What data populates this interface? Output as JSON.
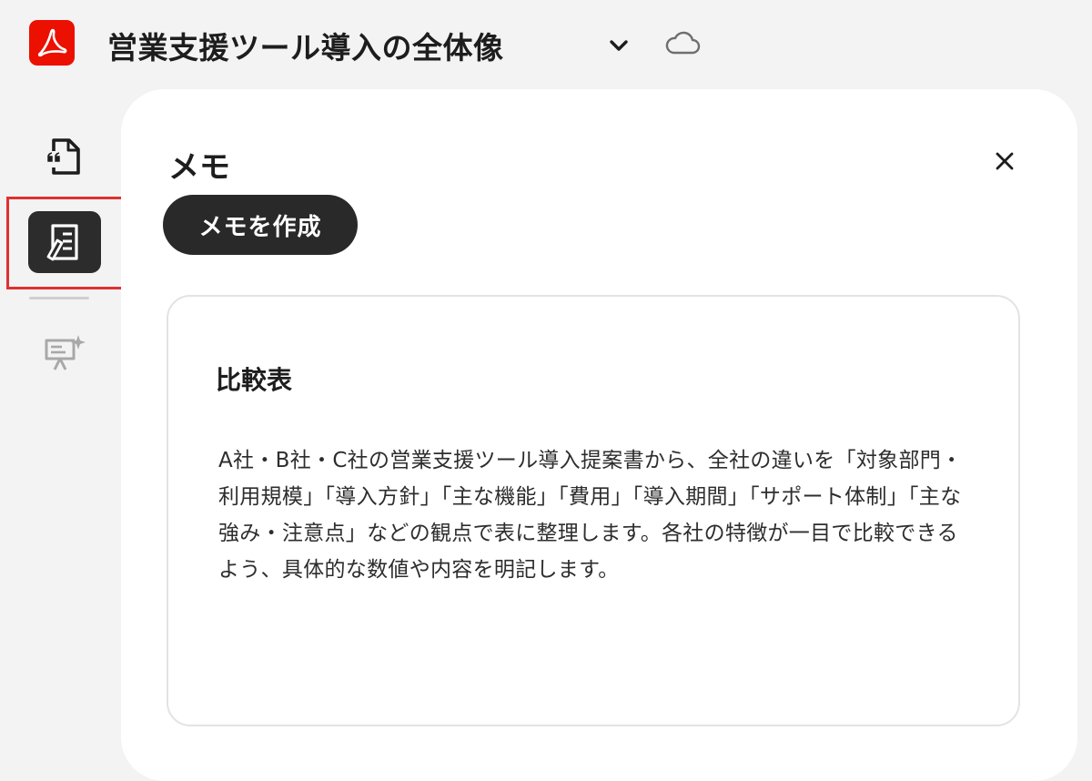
{
  "app": {
    "logo_icon": "acrobat-logo-icon",
    "brand_color": "#eb1000"
  },
  "header": {
    "document_title": "営業支援ツール導入の全体像",
    "chevron_icon": "chevron-down-icon",
    "cloud_icon": "cloud-icon"
  },
  "rail": {
    "items": [
      {
        "icon": "quote-document-icon",
        "active": false
      },
      {
        "icon": "notes-icon",
        "active": true
      },
      {
        "icon": "presentation-sparkle-icon",
        "active": false
      }
    ],
    "highlight_color": "#e03030"
  },
  "panel": {
    "title": "メモ",
    "close_icon": "close-icon",
    "create_button_label": "メモを作成"
  },
  "note": {
    "title": "比較表",
    "body": "A社・B社・C社の営業支援ツール導入提案書から、全社の違いを「対象部門・利用規模」「導入方針」「主な機能」「費用」「導入期間」「サポート体制」「主な強み・注意点」などの観点で表に整理します。各社の特徴が一目で比較できるよう、具体的な数値や内容を明記します。"
  }
}
